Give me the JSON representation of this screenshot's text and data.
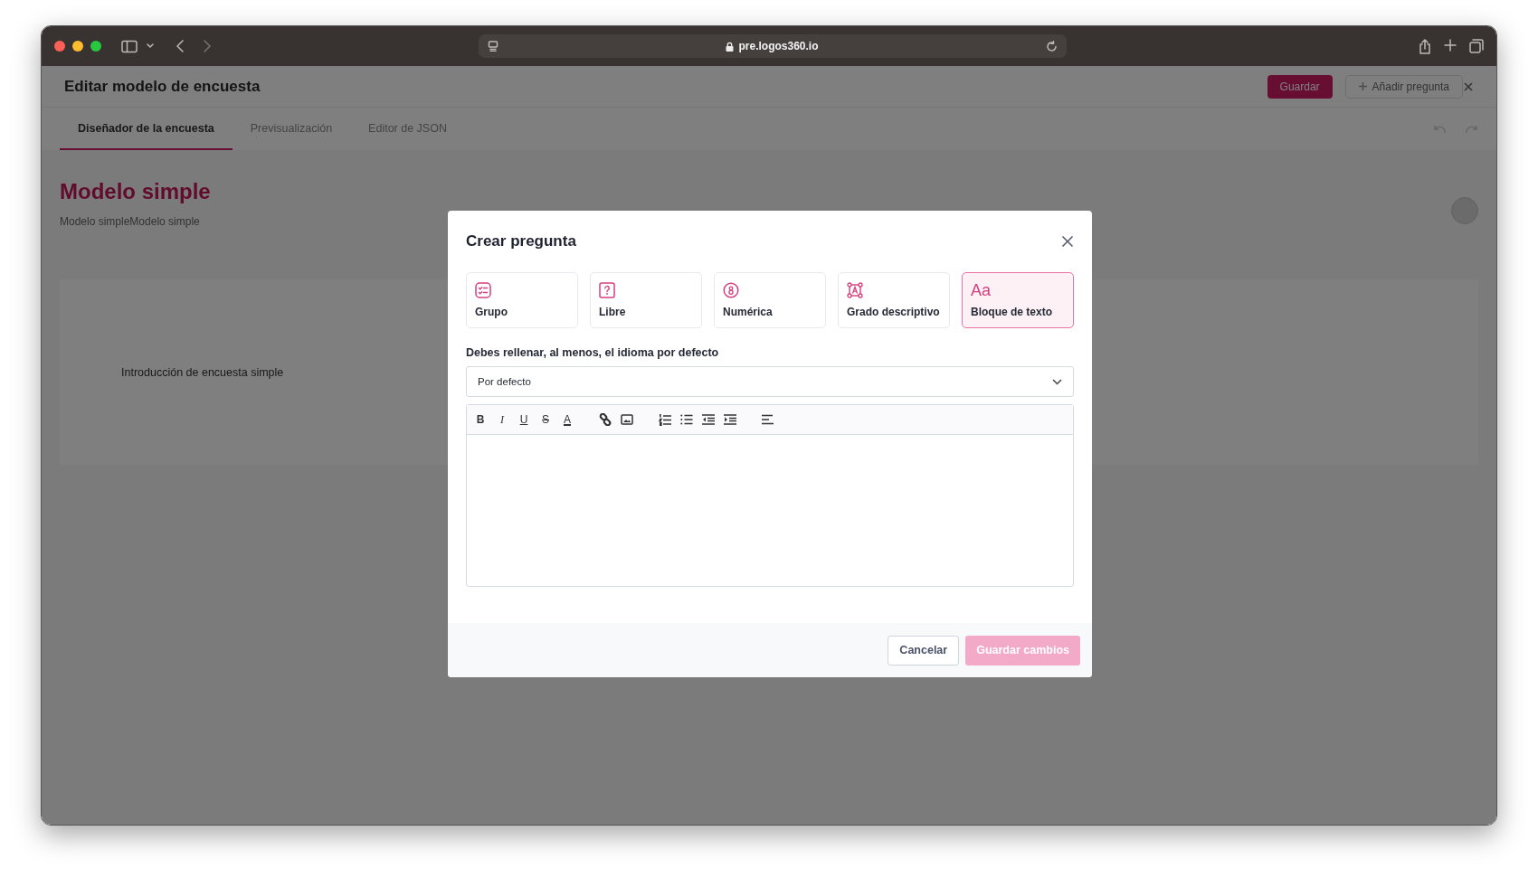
{
  "browser": {
    "url": "pre.logos360.io"
  },
  "page": {
    "title": "Editar modelo de encuesta",
    "buttons": [
      {
        "label": "Guardar",
        "kind": "primary"
      },
      {
        "label": "Añadir pregunta",
        "kind": "add"
      }
    ],
    "tabs": [
      {
        "label": "Diseñador de la encuesta",
        "selected": true
      },
      {
        "label": "Previsualización",
        "selected": false
      },
      {
        "label": "Editor de JSON",
        "selected": false
      }
    ],
    "survey_title": "Modelo simple",
    "survey_description": "Modelo simpleModelo simple",
    "intro": "Introducción de encuesta simple"
  },
  "modal": {
    "title": "Crear pregunta",
    "question_types": [
      {
        "label": "Grupo",
        "kind": "group",
        "selected": false
      },
      {
        "label": "Libre",
        "kind": "free",
        "selected": false
      },
      {
        "label": "Numérica",
        "kind": "numeric",
        "selected": false
      },
      {
        "label": "Grado descriptivo",
        "kind": "scale",
        "selected": false
      },
      {
        "label": "Bloque de texto",
        "kind": "text",
        "glyph": "Aa",
        "selected": true
      }
    ],
    "language_label": "Debes rellenar, al menos, el idioma por defecto",
    "language_select": {
      "value": "Por defecto"
    },
    "toolbar": [
      {
        "kind": "bold",
        "glyph": "B"
      },
      {
        "kind": "italic",
        "glyph": "I"
      },
      {
        "kind": "underline",
        "glyph": "U"
      },
      {
        "kind": "strike",
        "glyph": "S"
      },
      {
        "kind": "color",
        "glyph": "A"
      },
      {
        "kind": "sep"
      },
      {
        "kind": "link"
      },
      {
        "kind": "image"
      },
      {
        "kind": "sep"
      },
      {
        "kind": "ordered-list"
      },
      {
        "kind": "bullet-list"
      },
      {
        "kind": "outdent"
      },
      {
        "kind": "indent"
      },
      {
        "kind": "sep"
      },
      {
        "kind": "align"
      }
    ],
    "buttons": [
      {
        "label": "Cancelar",
        "kind": "secondary",
        "disabled": false
      },
      {
        "label": "Guardar cambios",
        "kind": "primary",
        "disabled": true
      }
    ]
  }
}
